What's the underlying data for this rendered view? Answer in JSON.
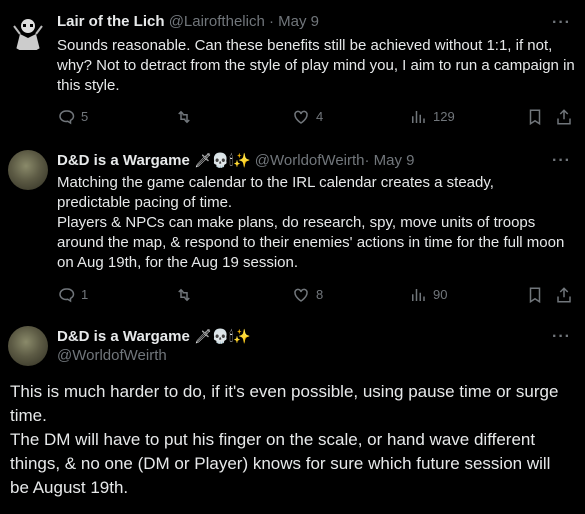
{
  "tweets": [
    {
      "name": "Lair of the Lich",
      "handle": "@Lairofthelich",
      "dot": "·",
      "time": "May 9",
      "more": "···",
      "text": "Sounds reasonable. Can these benefits still be achieved without 1:1, if not, why? Not to detract from the style of play mind you, I aim to run a campaign in this style.",
      "replies": "5",
      "retweets": "",
      "likes": "4",
      "views": "129"
    },
    {
      "name": "D&D is a Wargame",
      "name_emoji": "🗡💀🕯✨",
      "handle": "@WorldofWeirth",
      "dot": "·",
      "time": "May 9",
      "more": "···",
      "text_1": "Matching the game calendar to the IRL calendar creates a steady, predictable pacing of time.",
      "text_2": "Players & NPCs can make plans, do research, spy, move units of troops around the map, & respond to their enemies' actions in time for the full moon on Aug 19th, for the Aug 19 session.",
      "replies": "1",
      "retweets": "",
      "likes": "8",
      "views": "90"
    },
    {
      "name": "D&D is a Wargame",
      "name_emoji": "🗡💀🕯✨",
      "handle": "@WorldofWeirth",
      "more": "···",
      "text_1": "This is much harder to do, if it's even possible, using pause time or surge time.",
      "text_2": "The DM will have to put his finger on the scale, or hand wave different things, & no one (DM or Player) knows for sure which future session will be August 19th."
    }
  ],
  "icons": [
    "reply-icon",
    "retweet-icon",
    "like-icon",
    "views-icon",
    "bookmark-icon",
    "share-icon",
    "more-icon"
  ],
  "colors": {
    "background": "#000000",
    "text": "#e7e9ea",
    "muted": "#71767b"
  }
}
